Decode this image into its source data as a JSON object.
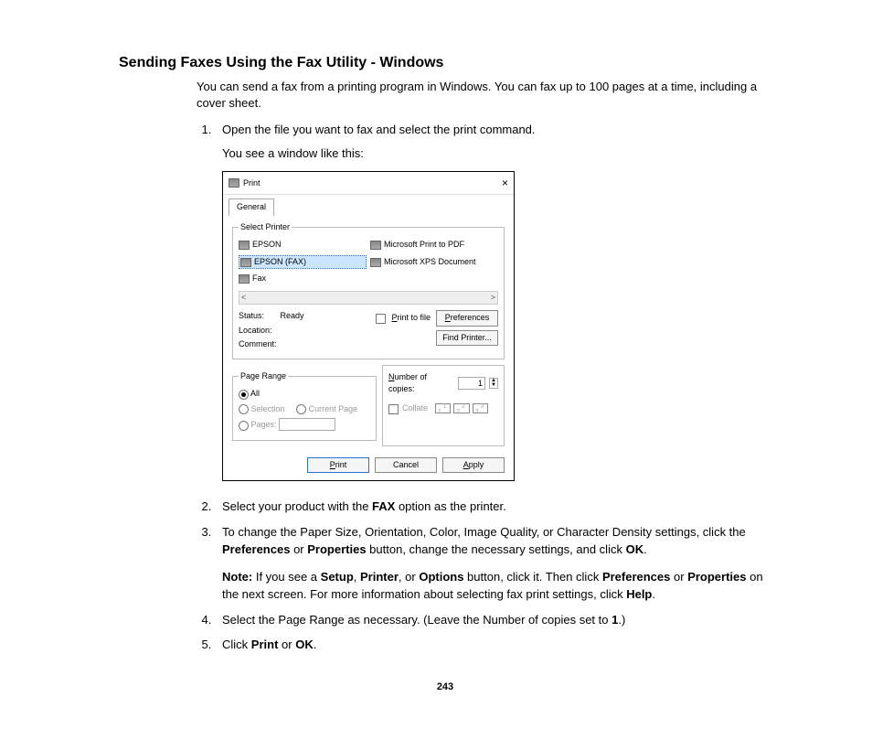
{
  "heading": "Sending Faxes Using the Fax Utility - Windows",
  "intro": "You can send a fax from a printing program in Windows. You can fax up to 100 pages at a time, including a cover sheet.",
  "steps": {
    "s1": "Open the file you want to fax and select the print command.",
    "s1b": "You see a window like this:",
    "s2a": "Select your product with the ",
    "s2b": "FAX",
    "s2c": " option as the printer.",
    "s3a": "To change the Paper Size, Orientation, Color, Image Quality, or Character Density settings, click the ",
    "s3b": "Preferences",
    "s3c": " or ",
    "s3d": "Properties",
    "s3e": " button, change the necessary settings, and click ",
    "s3f": "OK",
    "s3g": ".",
    "note_a": "Note:",
    "note_b": " If you see a ",
    "note_c": "Setup",
    "note_d": ", ",
    "note_e": "Printer",
    "note_f": ", or ",
    "note_g": "Options",
    "note_h": " button, click it. Then click ",
    "note_i": "Preferences",
    "note_j": " or ",
    "note_k": "Properties",
    "note_l": " on the next screen. For more information about selecting fax print settings, click ",
    "note_m": "Help",
    "note_n": ".",
    "s4a": "Select the Page Range as necessary. (Leave the Number of copies set to ",
    "s4b": "1",
    "s4c": ".)",
    "s5a": "Click ",
    "s5b": "Print",
    "s5c": " or ",
    "s5d": "OK",
    "s5e": "."
  },
  "dialog": {
    "title": "Print",
    "close": "×",
    "tab": "General",
    "select_printer": "Select Printer",
    "printers": {
      "p1": "EPSON",
      "p2": "EPSON (FAX)",
      "p3": "Fax",
      "p4": "Microsoft Print to PDF",
      "p5": "Microsoft XPS Document"
    },
    "scroll_left": "<",
    "scroll_right": ">",
    "status_label": "Status:",
    "status_value": "Ready",
    "location_label": "Location:",
    "comment_label": "Comment:",
    "print_to_file": "Print to file",
    "preferences_btn": "Preferences",
    "find_printer_btn": "Find Printer...",
    "page_range": "Page Range",
    "pr_all": "All",
    "pr_selection": "Selection",
    "pr_current": "Current Page",
    "pr_pages": "Pages:",
    "copies_label": "Number of copies:",
    "copies_value": "1",
    "collate": "Collate",
    "collate_icons": {
      "a": "1",
      "b": "1",
      "c": "2",
      "d": "2",
      "e": "3",
      "f": "3"
    },
    "btn_print": "Print",
    "btn_cancel": "Cancel",
    "btn_apply": "Apply"
  },
  "page_number": "243"
}
